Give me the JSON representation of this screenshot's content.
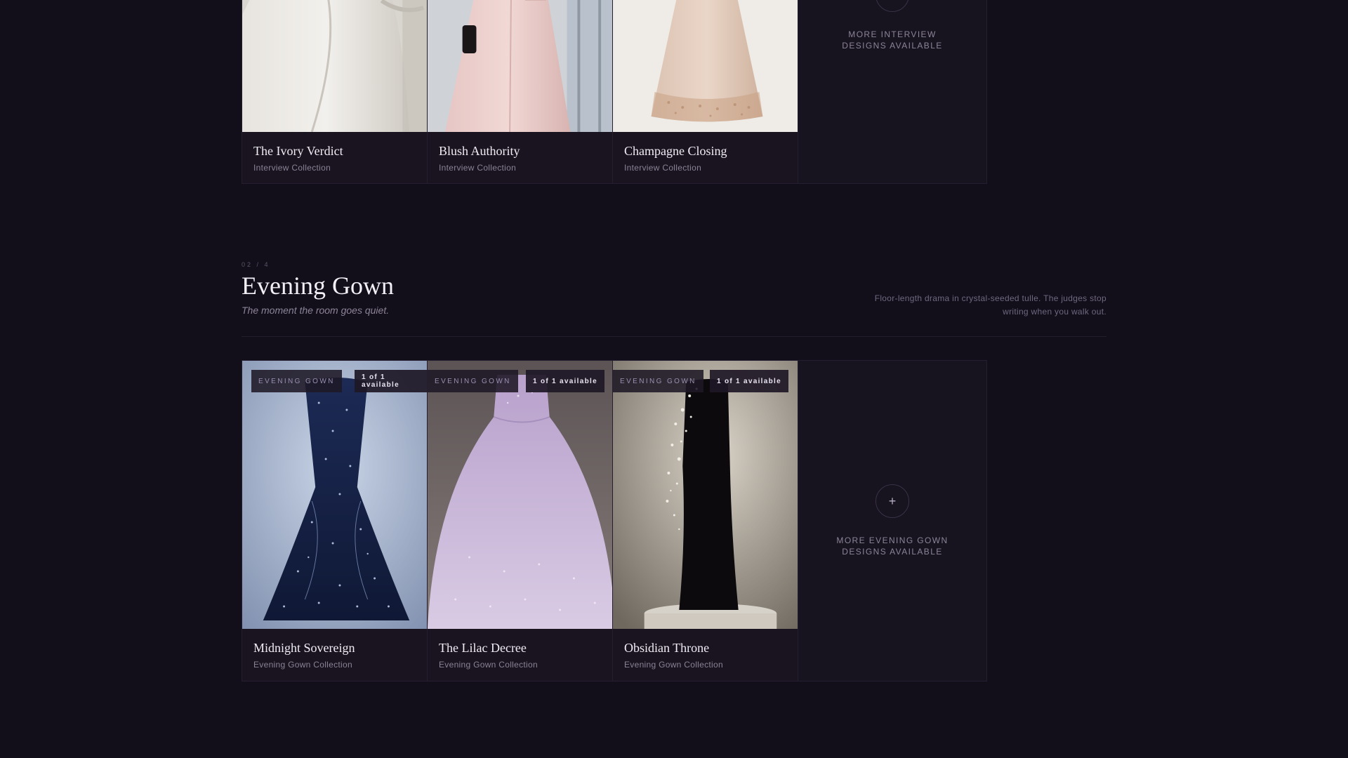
{
  "interview_section": {
    "cards": [
      {
        "name": "The Ivory Verdict",
        "collection": "Interview Collection"
      },
      {
        "name": "Blush Authority",
        "collection": "Interview Collection"
      },
      {
        "name": "Champagne Closing",
        "collection": "Interview Collection"
      }
    ],
    "more": {
      "icon": "plus-icon",
      "label": "MORE INTERVIEW DESIGNS AVAILABLE",
      "glyph": "+"
    }
  },
  "evening_section": {
    "counter": "02 / 4",
    "title": "Evening Gown",
    "tagline": "The moment the room goes quiet.",
    "description": "Floor-length drama in crystal-seeded tulle. The judges stop writing when you walk out.",
    "cards": [
      {
        "tag": "EVENING GOWN",
        "availability": "1 of 1 available",
        "name": "Midnight Sovereign",
        "collection": "Evening Gown Collection"
      },
      {
        "tag": "EVENING GOWN",
        "availability": "1 of 1 available",
        "name": "The Lilac Decree",
        "collection": "Evening Gown Collection"
      },
      {
        "tag": "EVENING GOWN",
        "availability": "1 of 1 available",
        "name": "Obsidian Throne",
        "collection": "Evening Gown Collection"
      }
    ],
    "more": {
      "icon": "plus-icon",
      "label": "MORE EVENING GOWN DESIGNS AVAILABLE",
      "glyph": "+"
    }
  },
  "colors": {
    "background": "#120e1a",
    "card": "#19141f",
    "border": "#241e30",
    "muted_text": "#8a8296"
  }
}
